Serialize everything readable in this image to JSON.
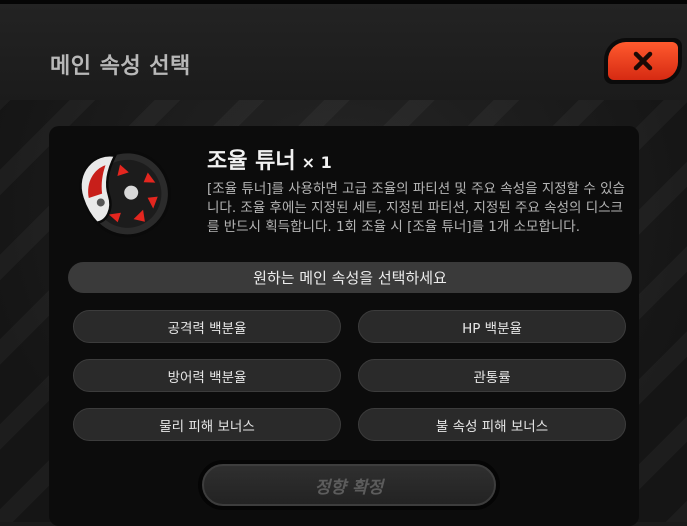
{
  "dialog": {
    "title": "메인 속성 선택",
    "close_icon": "close-icon"
  },
  "item": {
    "icon": "tuner-disc-icon",
    "name": "조율 튜너",
    "count": "× 1",
    "description": "[조율 튜너]를 사용하면 고급 조율의 파티션 및 주요 속성을 지정할 수 있습니다. 조율 후에는 지정된 세트, 지정된 파티션, 지정된 주요 속성의 디스크를 반드시 획득합니다. 1회 조율 시 [조율 튜너]를 1개 소모합니다."
  },
  "prompt": "원하는 메인 속성을 선택하세요",
  "options": [
    "공격력 백분율",
    "HP 백분율",
    "방어력 백분율",
    "관통률",
    "물리 피해 보너스",
    "불 속성 피해 보너스"
  ],
  "confirm_label": "정향 확정",
  "colors": {
    "close_accent": "#e8401c",
    "panel_bg": "#0c0c0c",
    "option_bg": "#2a2a2a"
  }
}
